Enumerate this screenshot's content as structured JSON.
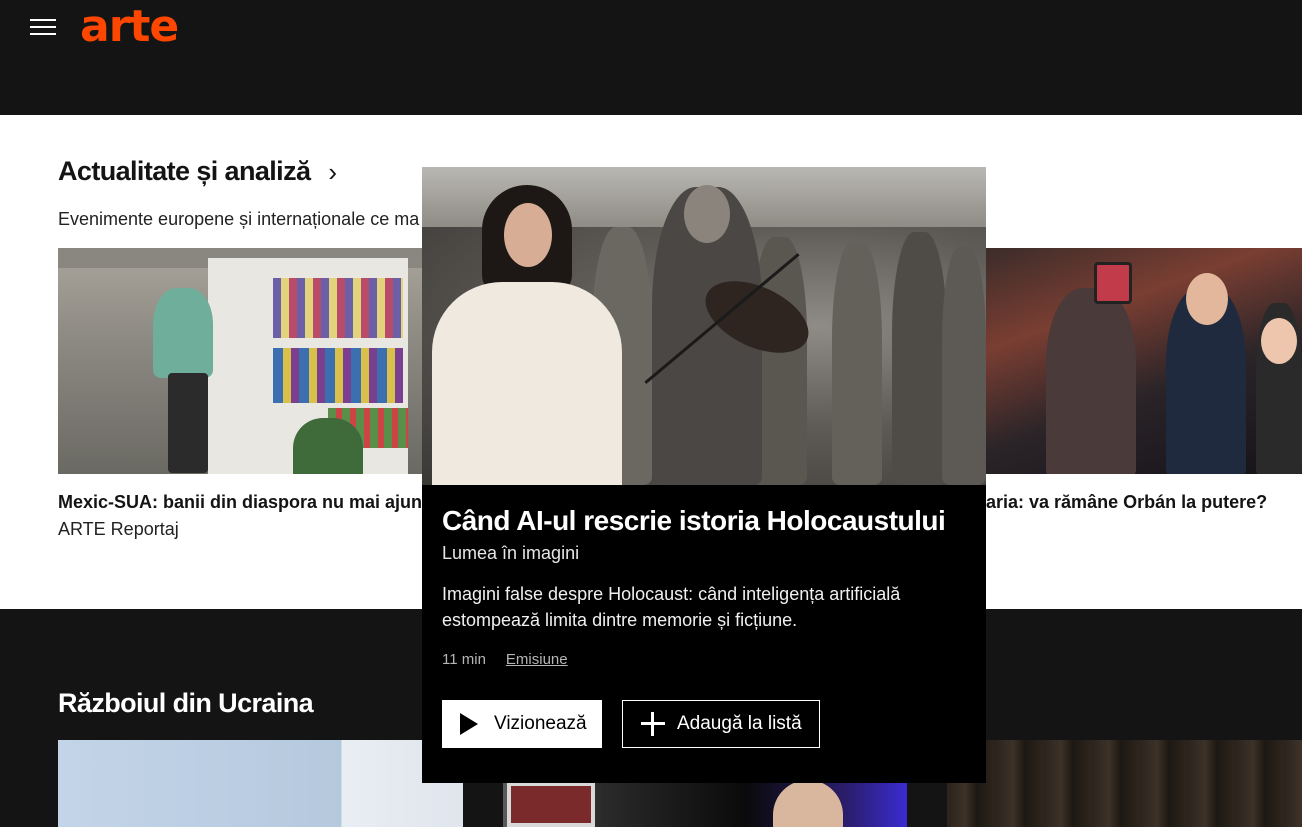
{
  "header": {
    "logo_text": "arte",
    "brand_color": "#fd4600"
  },
  "section_news": {
    "title": "Actualitate și analiză",
    "subtitle": "Evenimente europene și internaționale ce ma",
    "cards": [
      {
        "title": "Mexic-SUA: banii din diaspora nu mai ajung",
        "subtitle": "ARTE Reportaj"
      },
      {
        "title": "aria: va rămâne Orbán la putere?",
        "subtitle": ""
      }
    ]
  },
  "popup": {
    "title": "Când AI-ul rescrie istoria Holocaustului",
    "subtitle": "Lumea în imagini",
    "description": "Imagini false despre Holocaust: când inteligența artificială estompează limita dintre memorie și ficțiune.",
    "duration": "11 min",
    "category": "Emisiune",
    "watch_label": "Vizionează",
    "add_label": "Adaugă la listă"
  },
  "section_ukraine": {
    "title": "Războiul din Ucraina"
  }
}
